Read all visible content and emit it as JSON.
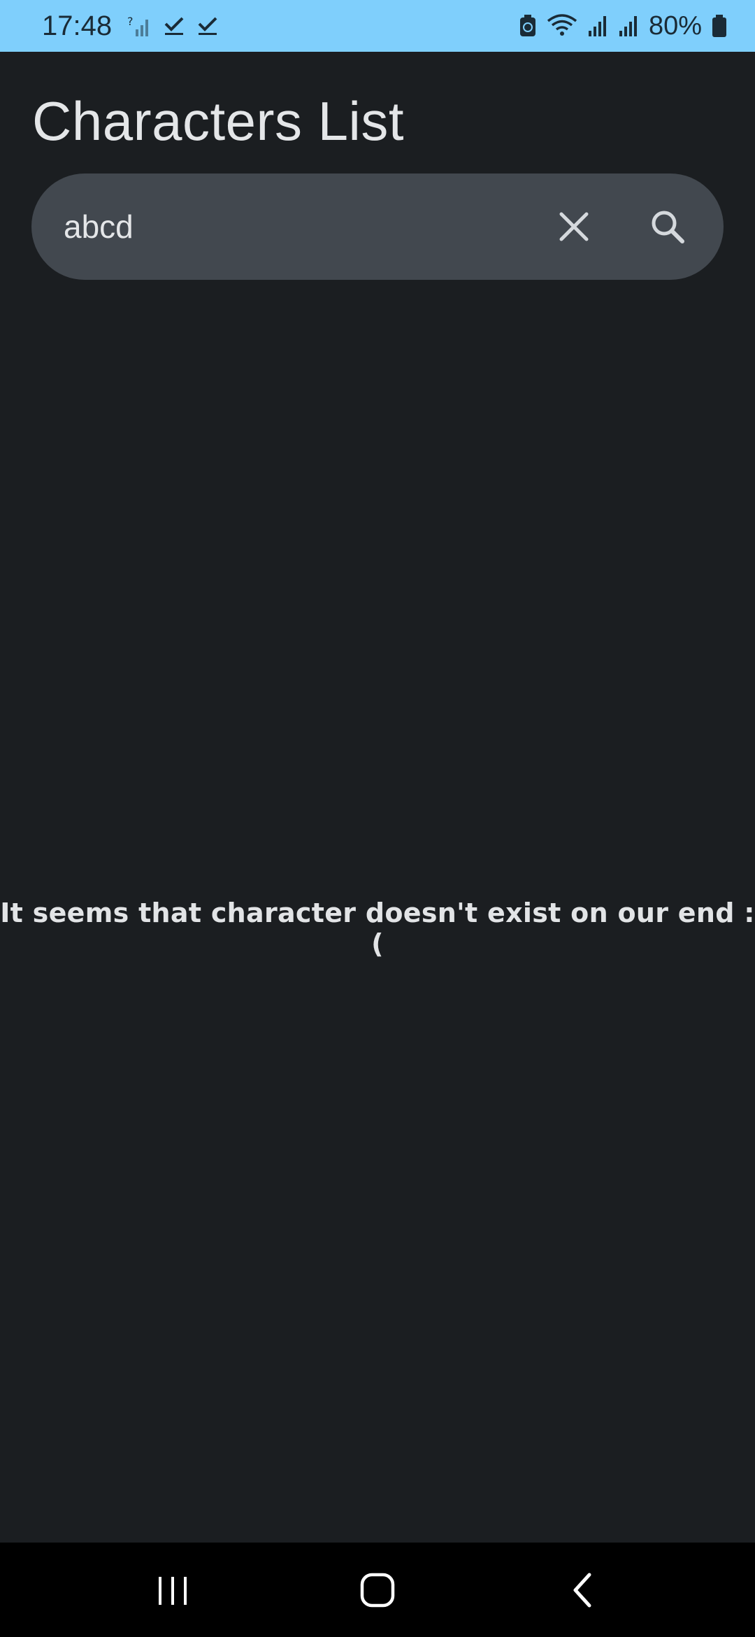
{
  "status_bar": {
    "time": "17:48",
    "battery_percent": "80%",
    "background_color": "#7fcffc",
    "icons_left": [
      "signal-unknown-icon",
      "check-icon",
      "check-icon"
    ],
    "icons_right": [
      "battery-saver-icon",
      "wifi-icon",
      "signal-icon",
      "signal-icon",
      "battery-icon"
    ]
  },
  "header": {
    "title": "Characters List"
  },
  "search": {
    "value": "abcd",
    "clear_icon": "close-icon",
    "search_icon": "search-icon"
  },
  "main": {
    "empty_message": "It seems that character doesn't exist on our end :("
  },
  "nav_bar": {
    "buttons": [
      "recents-icon",
      "home-icon",
      "back-icon"
    ]
  },
  "colors": {
    "background": "#1b1e21",
    "search_bar": "#42484f",
    "text": "#e4e6e8"
  }
}
